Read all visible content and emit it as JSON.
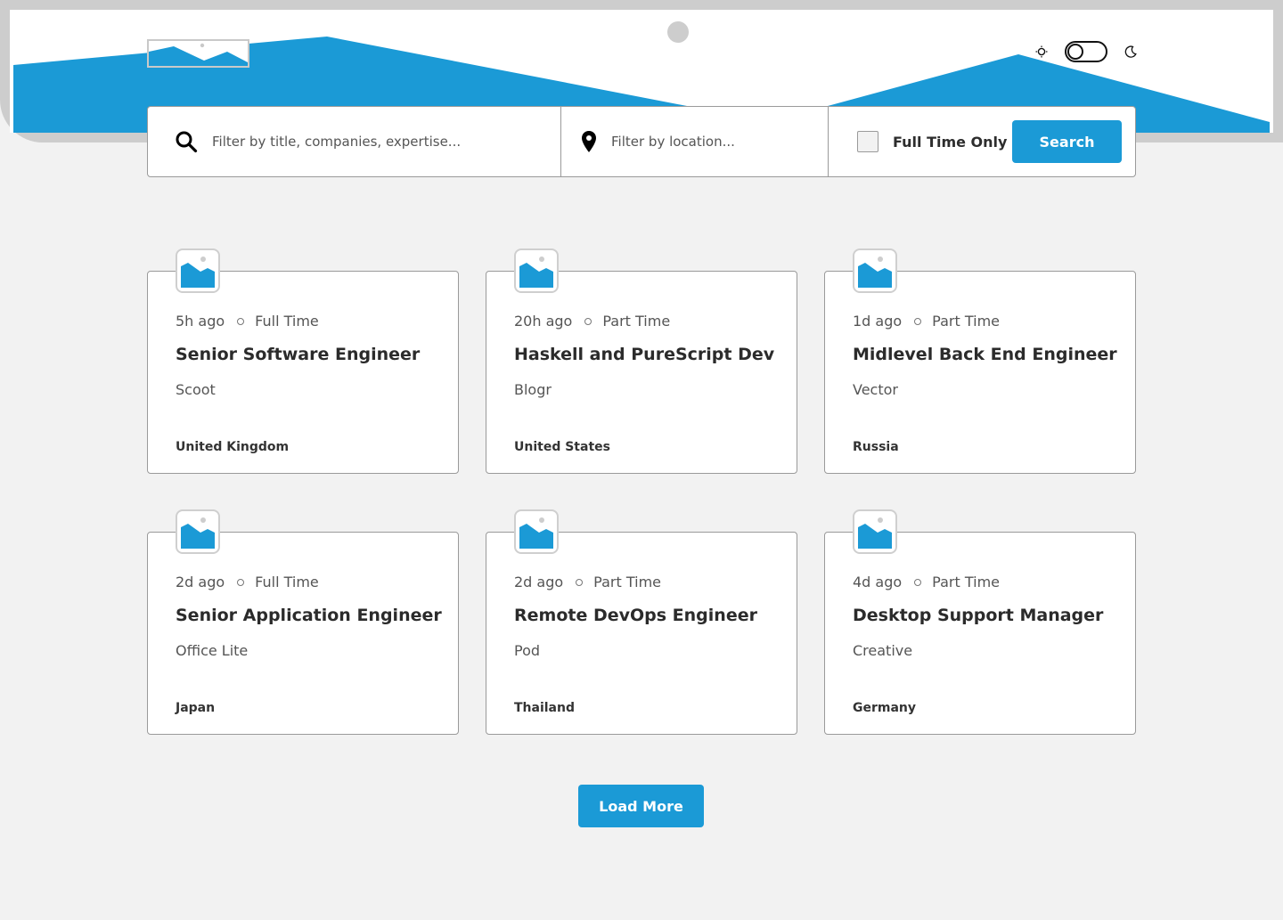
{
  "header": {
    "logo_icon": "image-placeholder-icon",
    "theme": {
      "light_icon": "sun-icon",
      "dark_icon": "moon-icon",
      "dark_mode": false
    }
  },
  "search": {
    "title_placeholder": "Filter by title, companies, expertise...",
    "location_placeholder": "Filter by location...",
    "full_time_label": "Full Time Only",
    "full_time_checked": false,
    "search_label": "Search"
  },
  "jobs": [
    {
      "posted": "5h ago",
      "contract": "Full Time",
      "position": "Senior Software Engineer",
      "company": "Scoot",
      "location": "United Kingdom"
    },
    {
      "posted": "20h ago",
      "contract": "Part Time",
      "position": "Haskell and PureScript Dev",
      "company": "Blogr",
      "location": "United States"
    },
    {
      "posted": "1d ago",
      "contract": "Part Time",
      "position": "Midlevel Back End Engineer",
      "company": "Vector",
      "location": "Russia"
    },
    {
      "posted": "2d ago",
      "contract": "Full Time",
      "position": "Senior Application Engineer",
      "company": "Office Lite",
      "location": "Japan"
    },
    {
      "posted": "2d ago",
      "contract": "Part Time",
      "position": "Remote DevOps Engineer",
      "company": "Pod",
      "location": "Thailand"
    },
    {
      "posted": "4d ago",
      "contract": "Part Time",
      "position": "Desktop Support Manager",
      "company": "Creative",
      "location": "Germany"
    }
  ],
  "load_more_label": "Load More",
  "colors": {
    "accent": "#1b9ad6",
    "background": "#f2f2f2",
    "card": "#ffffff",
    "placeholder_gray": "#cdcdcd"
  }
}
